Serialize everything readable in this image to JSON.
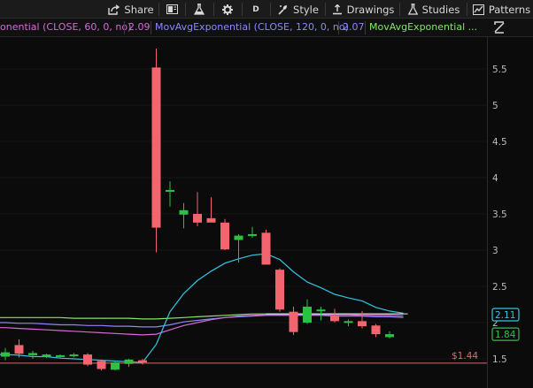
{
  "toolbar": {
    "share_label": "Share",
    "aggregation_label": "D",
    "style_label": "Style",
    "drawings_label": "Drawings",
    "studies_label": "Studies",
    "patterns_label": "Patterns"
  },
  "studies": [
    {
      "label": "onential (CLOSE, 60, 0, no)",
      "value": "2.09",
      "color": "#d46bd6"
    },
    {
      "label": "MovAvgExponential (CLOSE, 120, 0, no)",
      "value": "2.07",
      "color": "#8a87ff"
    },
    {
      "label": "MovAvgExponential ...",
      "color": "#86e36b"
    }
  ],
  "chart_data": {
    "type": "candlestick",
    "y_range": [
      1.3,
      5.9
    ],
    "y_ticks": [
      "5.5",
      "5",
      "4.5",
      "4",
      "3.5",
      "3",
      "2.5",
      "2",
      "1.5"
    ],
    "reference_line": {
      "label": "$1.44",
      "value": 1.44,
      "color": "#e16a6a"
    },
    "price_tags": [
      {
        "label": "2.11",
        "value": 2.11,
        "color": "#33c6e0"
      },
      {
        "label": "1.84",
        "value": 1.84,
        "color": "#2fbf4a"
      }
    ],
    "candles": [
      {
        "o": 1.53,
        "h": 1.65,
        "l": 1.48,
        "c": 1.59,
        "up": true
      },
      {
        "o": 1.69,
        "h": 1.77,
        "l": 1.52,
        "c": 1.57,
        "up": false
      },
      {
        "o": 1.55,
        "h": 1.61,
        "l": 1.5,
        "c": 1.58,
        "up": true
      },
      {
        "o": 1.53,
        "h": 1.57,
        "l": 1.51,
        "c": 1.56,
        "up": true
      },
      {
        "o": 1.53,
        "h": 1.56,
        "l": 1.51,
        "c": 1.55,
        "up": true
      },
      {
        "o": 1.54,
        "h": 1.58,
        "l": 1.52,
        "c": 1.56,
        "up": true
      },
      {
        "o": 1.56,
        "h": 1.58,
        "l": 1.4,
        "c": 1.42,
        "up": false
      },
      {
        "o": 1.47,
        "h": 1.49,
        "l": 1.34,
        "c": 1.36,
        "up": false
      },
      {
        "o": 1.35,
        "h": 1.47,
        "l": 1.34,
        "c": 1.45,
        "up": true
      },
      {
        "o": 1.43,
        "h": 1.5,
        "l": 1.39,
        "c": 1.49,
        "up": true
      },
      {
        "o": 1.48,
        "h": 1.5,
        "l": 1.42,
        "c": 1.45,
        "up": false
      },
      {
        "o": 5.52,
        "h": 5.78,
        "l": 2.97,
        "c": 3.31,
        "up": false
      },
      {
        "o": 3.82,
        "h": 3.95,
        "l": 3.6,
        "c": 3.83,
        "up": true
      },
      {
        "o": 3.49,
        "h": 3.65,
        "l": 3.3,
        "c": 3.55,
        "up": true
      },
      {
        "o": 3.5,
        "h": 3.8,
        "l": 3.33,
        "c": 3.38,
        "up": false
      },
      {
        "o": 3.44,
        "h": 3.73,
        "l": 3.39,
        "c": 3.38,
        "up": false
      },
      {
        "o": 3.38,
        "h": 3.43,
        "l": 3.0,
        "c": 3.01,
        "up": false
      },
      {
        "o": 3.14,
        "h": 3.22,
        "l": 2.83,
        "c": 3.2,
        "up": true
      },
      {
        "o": 3.2,
        "h": 3.32,
        "l": 3.17,
        "c": 3.22,
        "up": true
      },
      {
        "o": 3.24,
        "h": 3.28,
        "l": 2.84,
        "c": 2.8,
        "up": false
      },
      {
        "o": 2.73,
        "h": 2.75,
        "l": 2.15,
        "c": 2.18,
        "up": false
      },
      {
        "o": 2.15,
        "h": 2.22,
        "l": 1.83,
        "c": 1.87,
        "up": false
      },
      {
        "o": 2.0,
        "h": 2.32,
        "l": 1.98,
        "c": 2.22,
        "up": true
      },
      {
        "o": 2.18,
        "h": 2.22,
        "l": 2.03,
        "c": 2.17,
        "up": true
      },
      {
        "o": 2.1,
        "h": 2.19,
        "l": 2.0,
        "c": 2.02,
        "up": false
      },
      {
        "o": 2.0,
        "h": 2.04,
        "l": 1.95,
        "c": 2.02,
        "up": true
      },
      {
        "o": 2.02,
        "h": 2.16,
        "l": 1.92,
        "c": 1.95,
        "up": false
      },
      {
        "o": 1.96,
        "h": 1.98,
        "l": 1.8,
        "c": 1.84,
        "up": false
      },
      {
        "o": 1.8,
        "h": 1.88,
        "l": 1.78,
        "c": 1.84,
        "up": true
      }
    ],
    "ema_cyan": [
      1.56,
      1.55,
      1.53,
      1.53,
      1.51,
      1.5,
      1.49,
      1.48,
      1.47,
      1.46,
      1.45,
      1.7,
      2.15,
      2.4,
      2.58,
      2.71,
      2.82,
      2.88,
      2.93,
      2.95,
      2.87,
      2.7,
      2.56,
      2.48,
      2.39,
      2.34,
      2.3,
      2.21,
      2.16,
      2.13
    ],
    "ema_magenta": [
      1.93,
      1.92,
      1.91,
      1.9,
      1.89,
      1.88,
      1.87,
      1.86,
      1.85,
      1.84,
      1.83,
      1.84,
      1.9,
      1.96,
      2.0,
      2.04,
      2.07,
      2.09,
      2.1,
      2.11,
      2.11,
      2.11,
      2.11,
      2.11,
      2.11,
      2.11,
      2.1,
      2.1,
      2.1,
      2.09
    ],
    "ema_purple": [
      2.0,
      1.99,
      1.99,
      1.98,
      1.97,
      1.97,
      1.96,
      1.96,
      1.95,
      1.95,
      1.94,
      1.94,
      1.97,
      2.01,
      2.03,
      2.05,
      2.07,
      2.08,
      2.09,
      2.1,
      2.1,
      2.1,
      2.1,
      2.1,
      2.09,
      2.09,
      2.09,
      2.08,
      2.08,
      2.07
    ],
    "ema_green": [
      2.07,
      2.07,
      2.07,
      2.07,
      2.07,
      2.06,
      2.06,
      2.06,
      2.06,
      2.06,
      2.05,
      2.05,
      2.06,
      2.07,
      2.08,
      2.09,
      2.1,
      2.11,
      2.12,
      2.12,
      2.12,
      2.12,
      2.12,
      2.12,
      2.12,
      2.12,
      2.12,
      2.12,
      2.12,
      2.12
    ],
    "colors": {
      "up": "#2ac341",
      "down": "#f2646e",
      "cyan": "#33c6e0",
      "magenta": "#d46bd6",
      "purple": "#8a87ff",
      "green": "#86e36b",
      "white": "#e8e8e8"
    }
  }
}
